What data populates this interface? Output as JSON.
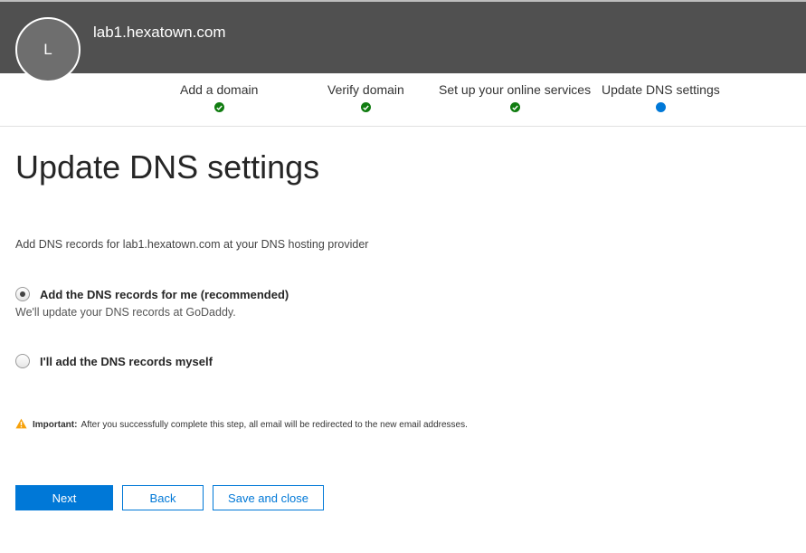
{
  "header": {
    "avatar_initial": "L",
    "domain": "lab1.hexatown.com"
  },
  "steps": [
    {
      "label": "Add a domain",
      "status": "complete"
    },
    {
      "label": "Verify domain",
      "status": "complete"
    },
    {
      "label": "Set up your online services",
      "status": "complete"
    },
    {
      "label": "Update DNS settings",
      "status": "current"
    }
  ],
  "page": {
    "title": "Update DNS settings",
    "intro": "Add DNS records for lab1.hexatown.com at your DNS hosting provider"
  },
  "options": [
    {
      "label": "Add the DNS records for me (recommended)",
      "description": "We'll update your DNS records at GoDaddy.",
      "selected": true
    },
    {
      "label": "I'll add the DNS records myself",
      "selected": false
    }
  ],
  "notice": {
    "icon": "warning-icon",
    "strong": "Important:",
    "text": "After you successfully complete this step, all email will be redirected to the new email addresses."
  },
  "buttons": {
    "next": "Next",
    "back": "Back",
    "save_close": "Save and close"
  },
  "colors": {
    "header_bg": "#505050",
    "accent": "#0078d7",
    "complete": "#107c10",
    "warning": "#f7a10a"
  }
}
